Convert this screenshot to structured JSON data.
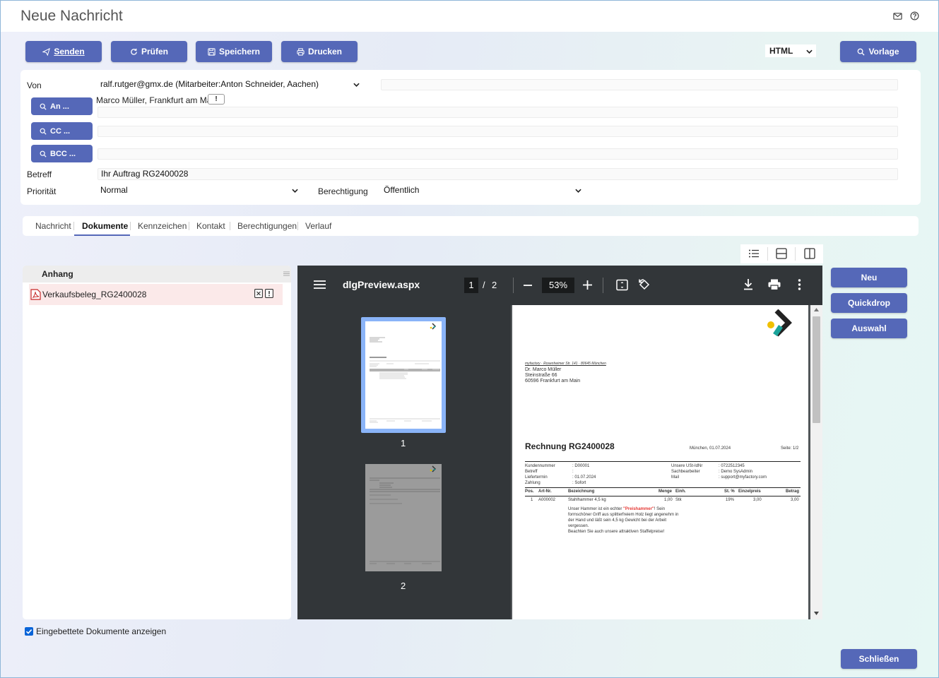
{
  "window": {
    "title": "Neue Nachricht"
  },
  "toolbar": {
    "send_label": "Senden",
    "check_label": "Prüfen",
    "save_label": "Speichern",
    "print_label": "Drucken",
    "format_value": "HTML",
    "template_label": "Vorlage"
  },
  "form": {
    "from_label": "Von",
    "from_value": "ralf.rutger@gmx.de (Mitarbeiter:Anton Schneider, Aachen)",
    "to_button": "An ...",
    "to_recipient": "Marco Müller, Frankfurt am Main",
    "to_recipient_badge": "!",
    "cc_button": "CC ...",
    "bcc_button": "BCC ...",
    "subject_label": "Betreff",
    "subject_value": "Ihr Auftrag RG2400028",
    "priority_label": "Priorität",
    "priority_value": "Normal",
    "permission_label": "Berechtigung",
    "permission_value": "Öffentlich"
  },
  "tabs": [
    {
      "label": "Nachricht"
    },
    {
      "label": "Dokumente",
      "active": true
    },
    {
      "label": "Kennzeichen"
    },
    {
      "label": "Kontakt"
    },
    {
      "label": "Berechtigungen"
    },
    {
      "label": "Verlauf"
    }
  ],
  "attachments": {
    "header": "Anhang",
    "items": [
      {
        "name": "Verkaufsbeleg_RG2400028"
      }
    ]
  },
  "viewer": {
    "filename": "dlgPreview.aspx",
    "current_page": "1",
    "page_sep": "/",
    "total_pages": "2",
    "zoom": "53%",
    "thumbs": [
      {
        "label": "1"
      },
      {
        "label": "2"
      }
    ]
  },
  "invoice": {
    "sender_line": "myfactory · Rosenheimer Str. 141 · 80645 München",
    "recipient": [
      "Dr. Marco Müller",
      "Steinstraße 66",
      "60596 Frankfurt am Main"
    ],
    "title": "Rechnung RG2400028",
    "date": "München, 01.07.2024",
    "page": "Seite: 1/2",
    "meta_left": [
      {
        "k": "Kundennummer",
        "v": ": D00001"
      },
      {
        "k": "Betreff",
        "v": ":"
      },
      {
        "k": "Liefertermin",
        "v": ": 01.07.2024"
      },
      {
        "k": "Zahlung",
        "v": ": Sofort"
      }
    ],
    "meta_right": [
      {
        "k": "Unsere USt-IdNr",
        "v": ": 0722512345"
      },
      {
        "k": "Sachbearbeiter",
        "v": ": Demo SysAdmin"
      },
      {
        "k": "Mail",
        "v": ": support@myfactory.com"
      }
    ],
    "columns": [
      "Pos.",
      "Art-Nr.",
      "Bezeichnung",
      "Menge",
      "Einh.",
      "St. %",
      "Einzelpreis",
      "Betrag"
    ],
    "row": [
      "1",
      "A000002",
      "Stahlhammer 4,5 kg",
      "1,00",
      "Stk",
      "19%",
      "3,00",
      "3,00"
    ],
    "desc_1a": "Unser Hammer ist ein echter ",
    "desc_1b": "\"Preishammer\"",
    "desc_1c": "! Sein",
    "desc_2": "formschöner Griff aus splitterfreiem Holz liegt angenehm in",
    "desc_3": "der Hand und läßt sein 4,5 kg Gewicht bei der Arbeit",
    "desc_4": "vergessen.",
    "desc_5": "Beachten Sie auch unsere attraktiven Staffelpreise!"
  },
  "side_buttons": {
    "new": "Neu",
    "quickdrop": "Quickdrop",
    "select": "Auswahl"
  },
  "footer": {
    "show_embedded_label": "Eingebettete Dokumente anzeigen",
    "close_label": "Schließen"
  },
  "colors": {
    "accent": "#5568b8",
    "viewer_bg": "#323639",
    "highlight": "#e53935"
  }
}
